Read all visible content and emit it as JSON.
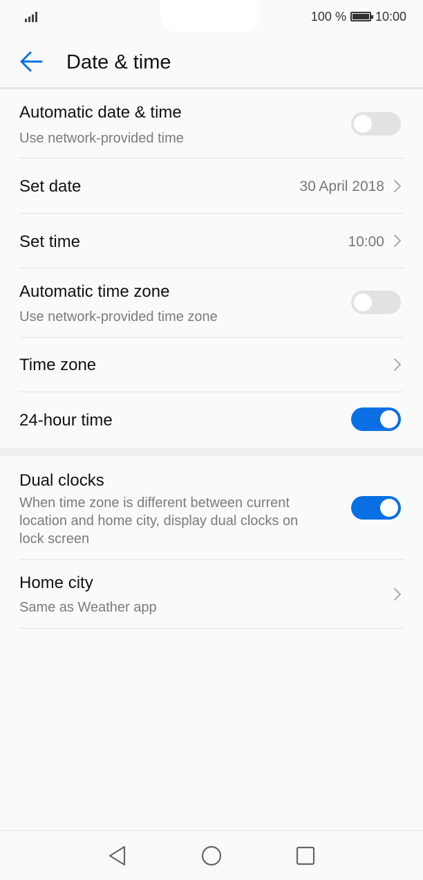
{
  "status_bar": {
    "battery_percent": "100 %",
    "time": "10:00"
  },
  "header": {
    "title": "Date & time"
  },
  "settings": {
    "automatic_date_time": {
      "title": "Automatic date & time",
      "subtitle": "Use network-provided time",
      "enabled": false
    },
    "set_date": {
      "title": "Set date",
      "value": "30 April 2018"
    },
    "set_time": {
      "title": "Set time",
      "value": "10:00"
    },
    "automatic_time_zone": {
      "title": "Automatic time zone",
      "subtitle": "Use network-provided time zone",
      "enabled": false
    },
    "time_zone": {
      "title": "Time zone"
    },
    "hour_24": {
      "title": "24-hour time",
      "enabled": true
    },
    "dual_clocks": {
      "title": "Dual clocks",
      "subtitle_line1": "When time zone is different between current",
      "subtitle_line2": "location and home city, display dual clocks on",
      "subtitle_line3": "lock screen",
      "enabled": true
    },
    "home_city": {
      "title": "Home city",
      "subtitle": "Same as Weather app"
    }
  },
  "colors": {
    "accent": "#0a6fe3",
    "toggle_off": "#e2e2e2",
    "secondary_text": "#7b7b7b"
  },
  "icons": {
    "back": "arrow-left-icon",
    "chevron": "chevron-right-icon",
    "nav_back": "triangle-back-icon",
    "nav_home": "circle-home-icon",
    "nav_recents": "square-recents-icon"
  }
}
